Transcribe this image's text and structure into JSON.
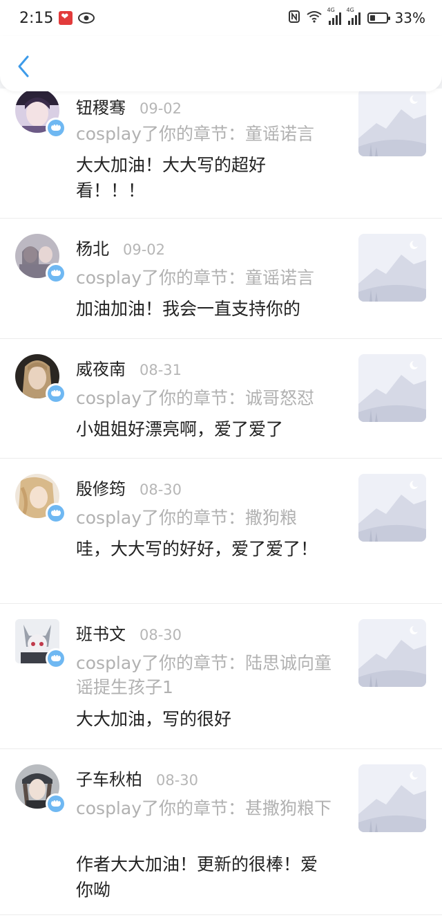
{
  "status_bar": {
    "time": "2:15",
    "battery_percent": "33%",
    "battery_level": 0.33,
    "network_label_1": "4G",
    "network_label_2": "4G"
  },
  "header": {
    "back_icon": "chevron-left-icon",
    "accent": "#3d9be9"
  },
  "comments": [
    {
      "name": "钮稷骞",
      "date": "09-02",
      "chapter": "cosplay了你的章节：童谣诺言",
      "text": "大大加油！大大写的超好看！！！",
      "avatar": "avatar-user-1"
    },
    {
      "name": "杨北",
      "date": "09-02",
      "chapter": "cosplay了你的章节：童谣诺言",
      "text": "加油加油！我会一直支持你的",
      "avatar": "avatar-user-2"
    },
    {
      "name": "威夜南",
      "date": "08-31",
      "chapter": "cosplay了你的章节：诚哥怒怼",
      "text": "小姐姐好漂亮啊，爱了爱了",
      "avatar": "avatar-user-3"
    },
    {
      "name": "殷修筠",
      "date": "08-30",
      "chapter": "cosplay了你的章节：撒狗粮",
      "text": "哇，大大写的好好，爱了爱了！",
      "avatar": "avatar-user-4"
    },
    {
      "name": "班书文",
      "date": "08-30",
      "chapter": "cosplay了你的章节：陆思诚向童谣提生孩子1",
      "text": "大大加油，写的很好",
      "avatar": "avatar-user-5"
    },
    {
      "name": "子车秋柏",
      "date": "08-30",
      "chapter": "cosplay了你的章节：甚撒狗粮下",
      "text": "作者大大加油！更新的很棒！爱你呦",
      "avatar": "avatar-user-6"
    }
  ],
  "colors": {
    "badge": "#6fb8f2",
    "date_gray": "#b6b6b6",
    "chapter_gray": "#b1b1b1"
  }
}
